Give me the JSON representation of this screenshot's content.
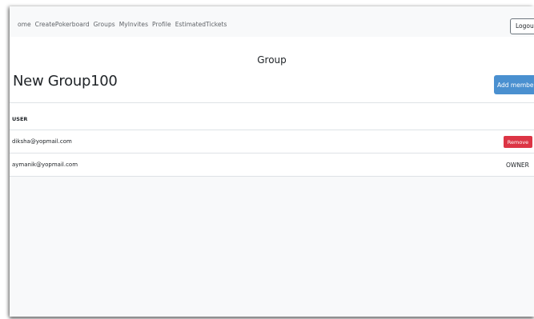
{
  "nav": {
    "links": [
      "ome",
      "CreatePokerboard",
      "Groups",
      "MyInvites",
      "Profile",
      "EstimatedTickets"
    ],
    "logout_label": "Logout"
  },
  "page": {
    "title": "Group",
    "group_name": "New Group100",
    "add_member_label": "Add member"
  },
  "table": {
    "header": "USER",
    "rows": [
      {
        "email": "diksha@yopmail.com",
        "action": "Remove"
      },
      {
        "email": "aymanik@yopmail.com",
        "role": "OWNER"
      }
    ]
  },
  "colors": {
    "navbar_bg": "#f8f9fa",
    "primary": "#4a90d0",
    "danger": "#dc3545",
    "divider": "#dee2e6"
  }
}
